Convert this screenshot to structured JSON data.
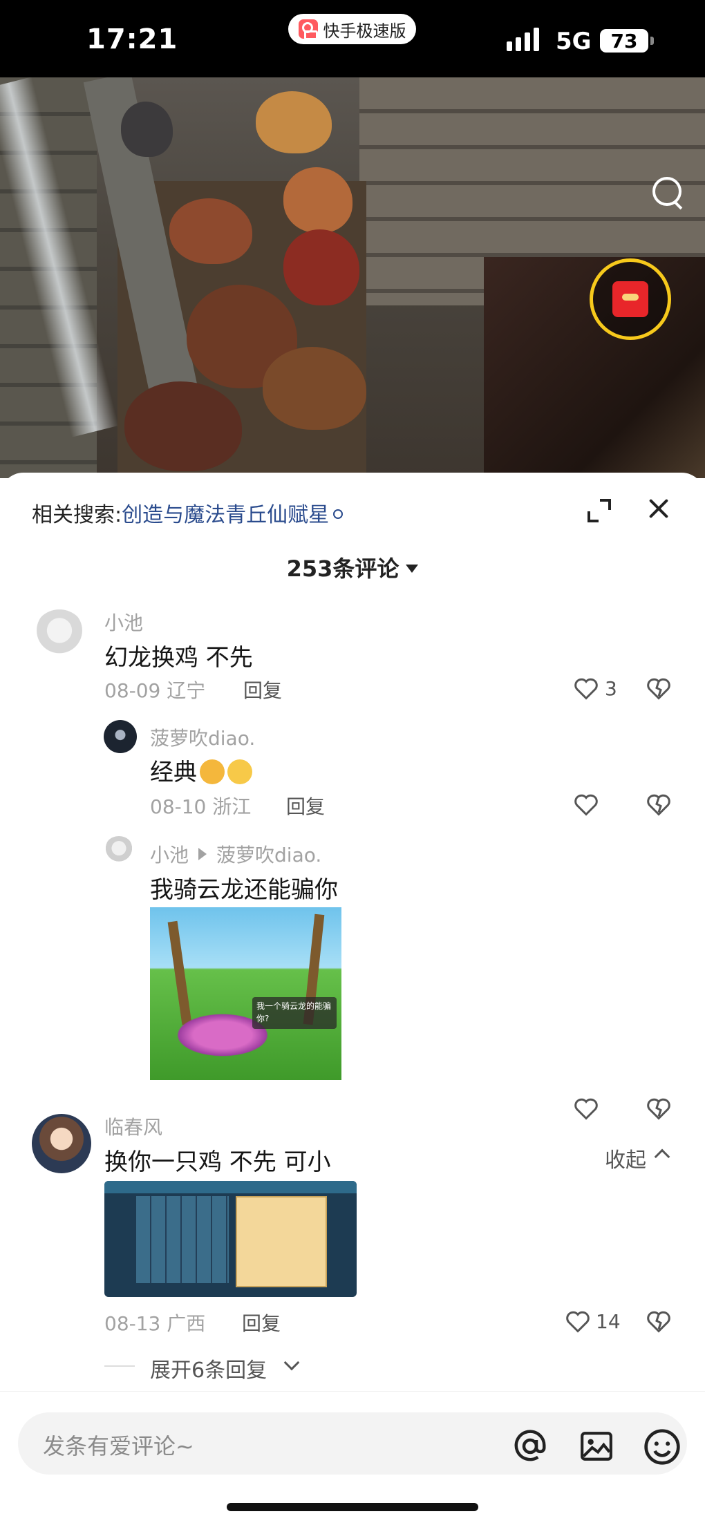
{
  "status_bar": {
    "time": "17:21",
    "app_name": "快手极速版",
    "network": "5G",
    "battery": "73"
  },
  "sheet": {
    "related_label": "相关搜索:",
    "related_keyword": "创造与魔法青丘仙赋星",
    "comment_count": "253条评论"
  },
  "comments": [
    {
      "user": "小池",
      "text": "幻龙换鸡 不先",
      "date": "08-09",
      "location": "辽宁",
      "reply_label": "回复",
      "likes": "3"
    },
    {
      "user": "菠萝吹diao.",
      "text": "经典",
      "date": "08-10",
      "location": "浙江",
      "reply_label": "回复",
      "likes": ""
    },
    {
      "user": "小池",
      "reply_to": "菠萝吹diao.",
      "text": "我骑云龙还能骗你",
      "image_caption": "我一个骑云龙的能骗你?",
      "likes": ""
    },
    {
      "user": "临春风",
      "text": "换你一只鸡 不先 可小",
      "collapse_label": "收起",
      "date": "08-13",
      "location": "广西",
      "reply_label": "回复",
      "likes": "14"
    }
  ],
  "expand_replies": "展开6条回复",
  "input": {
    "placeholder": "发条有爱评论~"
  },
  "icons": [
    "search-icon",
    "red-envelope-icon",
    "expand-icon",
    "close-icon",
    "heart-icon",
    "dislike-icon",
    "at-icon",
    "image-icon",
    "emoji-icon"
  ],
  "colors": {
    "keyword": "#2a4b8d",
    "ring": "#f7c91c",
    "envelope": "#e8262a"
  }
}
